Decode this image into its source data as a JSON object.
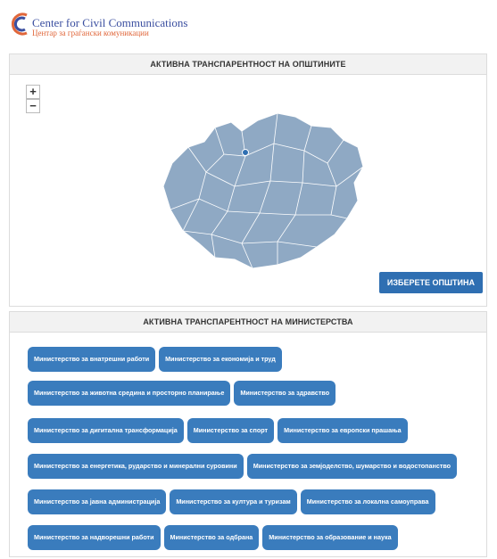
{
  "logo": {
    "line1": "Center for Civil Communications",
    "line2": "Центар за граѓански комуникации"
  },
  "map_panel": {
    "title": "АКТИВНА ТРАНСПАРЕНТНОСТ НА ОПШТИНИТЕ",
    "zoom_in": "+",
    "zoom_out": "−",
    "select_button": "ИЗБЕРЕТЕ ОПШТИНА",
    "map_color": "#8fa9c4",
    "marker_color": "#2f6fb2"
  },
  "ministries_panel": {
    "title": "АКТИВНА ТРАНСПАРЕНТНОСТ НА МИНИСТЕРСТВА",
    "button_color": "#3a7cbd",
    "rows": [
      [
        "Министерство за внатрешни работи",
        "Министерство за економија и труд"
      ],
      [
        "Министерство за животна средина и просторно планирање",
        "Министерство за здравство"
      ],
      [
        "Министерство за дигитална трансформација",
        "Министерство за спорт",
        "Министерство за европски прашања"
      ],
      [
        "Министерство за енергетика, рударство и минерални суровини",
        "Министерство за земјоделство, шумарство и водостопанство"
      ],
      [
        "Министерство за јавна администрација",
        "Министерство за култура и туризам",
        "Министерство за локална самоуправа"
      ],
      [
        "Министерство за надворешни работи",
        "Министерство за одбрана",
        "Министерство за образование и наука"
      ]
    ]
  }
}
